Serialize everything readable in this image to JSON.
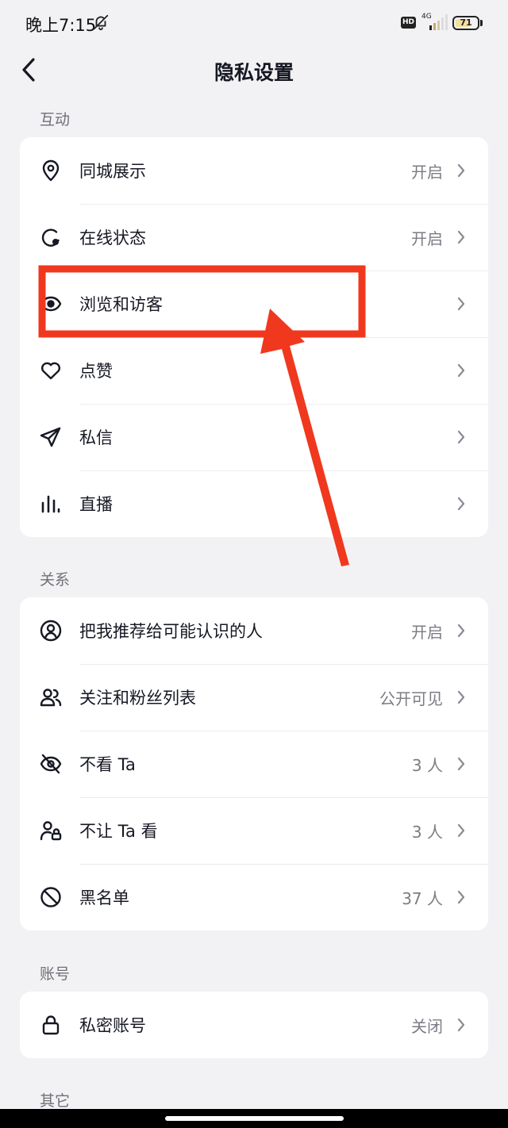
{
  "status_bar": {
    "time": "晚上7:15",
    "hd_badge": "HD",
    "network": "4G",
    "battery": "71",
    "battery_level": 0.71,
    "icons": [
      "bell-muted-icon",
      "signal-icon",
      "battery-icon"
    ]
  },
  "header": {
    "title": "隐私设置",
    "back_icon": "chevron-left-icon"
  },
  "sections": [
    {
      "label": "互动",
      "items": [
        {
          "label": "同城展示",
          "value": "开启",
          "icon": "location-pin-icon"
        },
        {
          "label": "在线状态",
          "value": "开启",
          "icon": "online-status-icon"
        },
        {
          "label": "浏览和访客",
          "value": "",
          "icon": "eye-icon"
        },
        {
          "label": "点赞",
          "value": "",
          "icon": "heart-icon"
        },
        {
          "label": "私信",
          "value": "",
          "icon": "paper-plane-icon"
        },
        {
          "label": "直播",
          "value": "",
          "icon": "bar-chart-icon"
        }
      ]
    },
    {
      "label": "关系",
      "items": [
        {
          "label": "把我推荐给可能认识的人",
          "value": "开启",
          "icon": "user-circle-icon"
        },
        {
          "label": "关注和粉丝列表",
          "value": "公开可见",
          "icon": "users-icon"
        },
        {
          "label": "不看 Ta",
          "value": "3 人",
          "icon": "eye-off-icon"
        },
        {
          "label": "不让 Ta 看",
          "value": "3 人",
          "icon": "user-lock-icon"
        },
        {
          "label": "黑名单",
          "value": "37 人",
          "icon": "block-icon"
        }
      ]
    },
    {
      "label": "账号",
      "items": [
        {
          "label": "私密账号",
          "value": "关闭",
          "icon": "lock-icon"
        }
      ]
    },
    {
      "label": "其它",
      "items": []
    }
  ],
  "annotation": {
    "highlight_color": "#f0381e",
    "target": "浏览和访客"
  },
  "colors": {
    "background": "#f2f2f4",
    "card": "#ffffff",
    "text_primary": "#161823",
    "text_secondary": "#7c7d85"
  }
}
